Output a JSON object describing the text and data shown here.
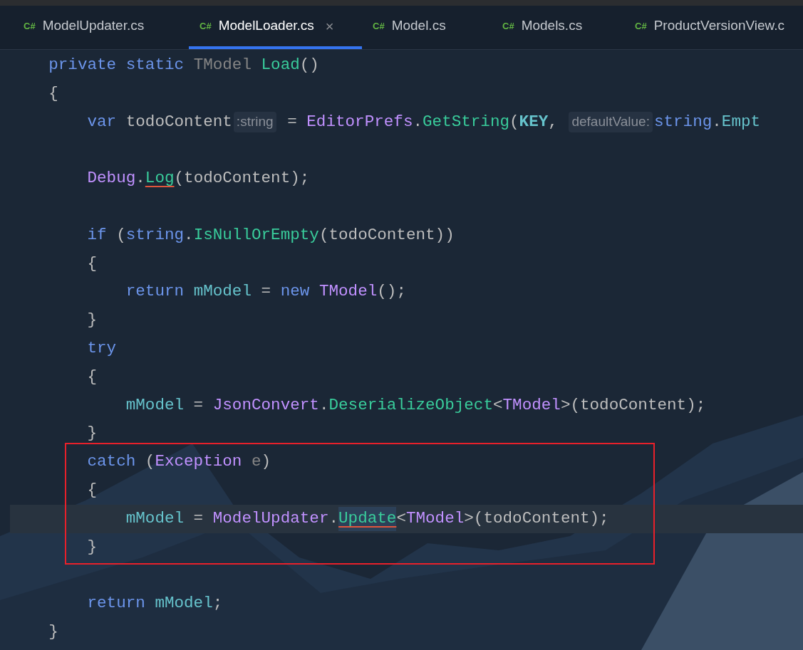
{
  "tabs": [
    {
      "icon": "C#",
      "label": "ModelUpdater.cs",
      "selected": false
    },
    {
      "icon": "C#",
      "label": "ModelLoader.cs",
      "selected": true,
      "close": "×"
    },
    {
      "icon": "C#",
      "label": "Model.cs",
      "selected": false
    },
    {
      "icon": "C#",
      "label": "Models.cs",
      "selected": false
    },
    {
      "icon": "C#",
      "label": "ProductVersionView.c",
      "selected": false
    }
  ],
  "blocks": [
    {
      "kind": "plain",
      "lines": [
        {
          "kind": "text",
          "tokens": [
            {
              "kind": "kw",
              "text": "    private static "
            },
            {
              "kind": "dim",
              "text": "TModel "
            },
            {
              "kind": "method",
              "text": "Load"
            },
            {
              "kind": "plain",
              "text": "()"
            }
          ]
        },
        {
          "kind": "text",
          "tokens": [
            {
              "kind": "plain",
              "text": "    {"
            }
          ]
        },
        {
          "kind": "text",
          "tokens": [
            {
              "kind": "kw",
              "text": "        var"
            },
            {
              "kind": "plain",
              "text": " todoContent"
            },
            {
              "kind": "hint",
              "text": ":string"
            },
            {
              "kind": "plain",
              "text": " = "
            },
            {
              "kind": "type",
              "text": "EditorPrefs"
            },
            {
              "kind": "plain",
              "text": "."
            },
            {
              "kind": "method",
              "text": "GetString"
            },
            {
              "kind": "plain",
              "text": "("
            },
            {
              "kind": "constant",
              "text": "KEY"
            },
            {
              "kind": "plain",
              "text": ", "
            },
            {
              "kind": "hint",
              "text": "defaultValue:"
            },
            {
              "kind": "kw",
              "text": "string"
            },
            {
              "kind": "plain",
              "text": "."
            },
            {
              "kind": "field",
              "text": "Empt"
            }
          ]
        },
        {
          "kind": "blank"
        },
        {
          "kind": "text",
          "tokens": [
            {
              "kind": "type",
              "text": "        Debug"
            },
            {
              "kind": "plain",
              "text": "."
            },
            {
              "kind": "method",
              "text": "Log",
              "underlined": true
            },
            {
              "kind": "plain",
              "text": "(todoContent);"
            }
          ]
        },
        {
          "kind": "blank"
        },
        {
          "kind": "text",
          "tokens": [
            {
              "kind": "kw",
              "text": "        if "
            },
            {
              "kind": "plain",
              "text": "("
            },
            {
              "kind": "kw",
              "text": "string"
            },
            {
              "kind": "plain",
              "text": "."
            },
            {
              "kind": "method",
              "text": "IsNullOrEmpty"
            },
            {
              "kind": "plain",
              "text": "(todoContent))"
            }
          ]
        },
        {
          "kind": "text",
          "tokens": [
            {
              "kind": "plain",
              "text": "        {"
            }
          ]
        },
        {
          "kind": "text",
          "tokens": [
            {
              "kind": "kw",
              "text": "            return "
            },
            {
              "kind": "field",
              "text": "mModel"
            },
            {
              "kind": "plain",
              "text": " = "
            },
            {
              "kind": "kw",
              "text": "new "
            },
            {
              "kind": "type",
              "text": "TModel"
            },
            {
              "kind": "plain",
              "text": "();"
            }
          ]
        },
        {
          "kind": "text",
          "tokens": [
            {
              "kind": "plain",
              "text": "        }"
            }
          ]
        },
        {
          "kind": "text",
          "tokens": [
            {
              "kind": "kw",
              "text": "        try"
            }
          ]
        },
        {
          "kind": "text",
          "tokens": [
            {
              "kind": "plain",
              "text": "        {"
            }
          ]
        },
        {
          "kind": "text",
          "tokens": [
            {
              "kind": "field",
              "text": "            mModel"
            },
            {
              "kind": "plain",
              "text": " = "
            },
            {
              "kind": "type",
              "text": "JsonConvert"
            },
            {
              "kind": "plain",
              "text": "."
            },
            {
              "kind": "method",
              "text": "DeserializeObject"
            },
            {
              "kind": "plain",
              "text": "<"
            },
            {
              "kind": "type",
              "text": "TModel"
            },
            {
              "kind": "plain",
              "text": ">(todoContent);"
            }
          ]
        },
        {
          "kind": "text",
          "tokens": [
            {
              "kind": "plain",
              "text": "        }"
            }
          ]
        }
      ]
    },
    {
      "kind": "boxed",
      "lines": [
        {
          "kind": "text",
          "tokens": [
            {
              "kind": "kw",
              "text": "        catch "
            },
            {
              "kind": "plain",
              "text": "("
            },
            {
              "kind": "type",
              "text": "Exception "
            },
            {
              "kind": "dim",
              "text": "e"
            },
            {
              "kind": "plain",
              "text": ")"
            }
          ]
        },
        {
          "kind": "text",
          "tokens": [
            {
              "kind": "plain",
              "text": "        {"
            }
          ]
        },
        {
          "kind": "text",
          "tokens": [
            {
              "kind": "field",
              "text": "            mModel"
            },
            {
              "kind": "plain",
              "text": " = "
            },
            {
              "kind": "type",
              "text": "ModelUpdater"
            },
            {
              "kind": "plain",
              "text": "."
            },
            {
              "kind": "method",
              "text": "Update",
              "underlined": true,
              "caret": true
            },
            {
              "kind": "plain",
              "text": "<"
            },
            {
              "kind": "type",
              "text": "TModel"
            },
            {
              "kind": "plain",
              "text": ">(todoContent);"
            }
          ]
        },
        {
          "kind": "text",
          "tokens": [
            {
              "kind": "plain",
              "text": "        }"
            }
          ]
        }
      ]
    },
    {
      "kind": "plain",
      "lines": [
        {
          "kind": "blank"
        },
        {
          "kind": "text",
          "tokens": [
            {
              "kind": "kw",
              "text": "        return "
            },
            {
              "kind": "field",
              "text": "mModel"
            },
            {
              "kind": "plain",
              "text": ";"
            }
          ]
        },
        {
          "kind": "text",
          "tokens": [
            {
              "kind": "plain",
              "text": "    }"
            }
          ]
        }
      ]
    }
  ]
}
